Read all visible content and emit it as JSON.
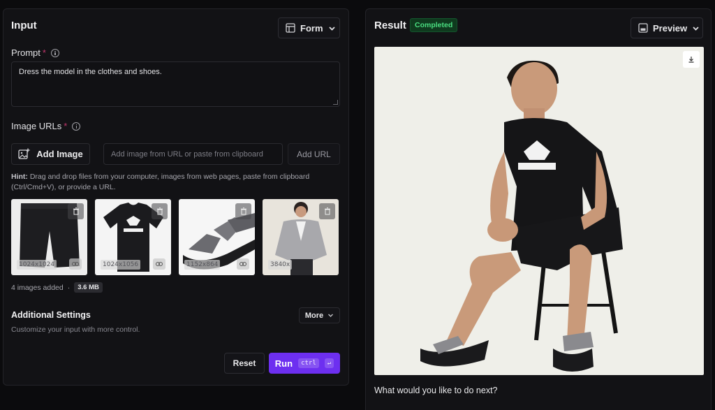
{
  "input_panel": {
    "title": "Input",
    "form_dropdown": "Form",
    "prompt_label": "Prompt",
    "prompt_required": "*",
    "prompt_value": "Dress the model in the clothes and shoes.",
    "image_urls_label": "Image URLs",
    "image_urls_required": "*",
    "add_image_button": "Add Image",
    "url_placeholder": "Add image from URL or paste from clipboard",
    "add_url_button": "Add URL",
    "hint_prefix": "Hint:",
    "hint_text": " Drag and drop files from your computer, images from web pages, paste from clipboard (Ctrl/Cmd+V), or provide a URL.",
    "thumbnails": [
      {
        "name": "shorts",
        "dims": "1024x1024"
      },
      {
        "name": "tshirt",
        "dims": "1024x1056"
      },
      {
        "name": "sandals",
        "dims": "1152x864"
      },
      {
        "name": "model",
        "dims": "3840x"
      }
    ],
    "images_added": "4 images added",
    "separator": "·",
    "total_size": "3.6 MB",
    "additional_settings_title": "Additional Settings",
    "additional_settings_desc": "Customize your input with more control.",
    "more_dropdown": "More",
    "reset_button": "Reset",
    "run_button": "Run",
    "run_shortcut_ctrl": "ctrl",
    "run_shortcut_enter": "↵"
  },
  "result_panel": {
    "title": "Result",
    "status": "Completed",
    "preview_dropdown": "Preview",
    "next_prompt": "What would you like to do next?"
  },
  "colors": {
    "accent_purple": "#6d2ff0",
    "status_green": "#4ade80",
    "required_pink": "#c0366b"
  }
}
